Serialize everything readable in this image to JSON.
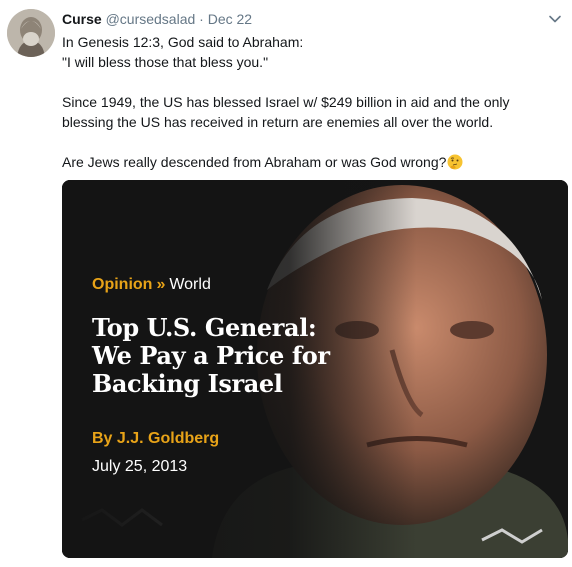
{
  "tweet": {
    "author_name": "Curse",
    "author_handle": "@cursedsalad",
    "separator": "·",
    "date": "Dec 22",
    "lines": [
      "In Genesis 12:3, God said to Abraham:",
      "\"I will bless those that bless you.\"",
      "Since 1949, the US has blessed Israel w/ $249 billion in aid and the only blessing the US has received in return are enemies all over the world.",
      "Are Jews really descended from Abraham or was God wrong?"
    ],
    "emoji": "thinking-face-icon"
  },
  "media": {
    "kicker_section": "Opinion",
    "kicker_separator": "»",
    "kicker_topic": "World",
    "headline": "Top U.S. General: We Pay a Price for Backing Israel",
    "byline": "By J.J. Goldberg",
    "date": "July 25, 2013"
  },
  "colors": {
    "accent": "#e8a318",
    "muted": "#657786",
    "text": "#14171a"
  }
}
